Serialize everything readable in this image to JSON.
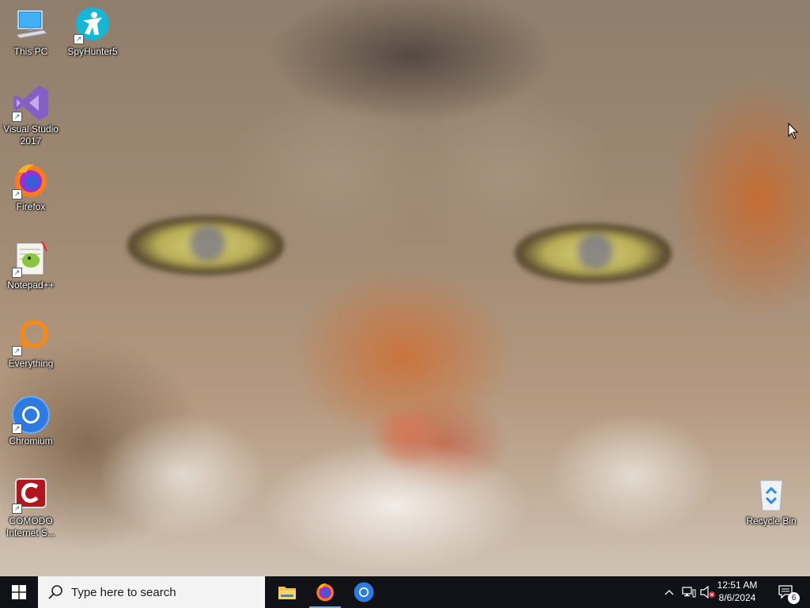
{
  "desktop": {
    "icons": [
      {
        "label": "This PC",
        "icon": "this-pc-icon"
      },
      {
        "label": "SpyHunter5",
        "icon": "spyhunter-icon"
      },
      {
        "label": "Visual Studio 2017",
        "icon": "visual-studio-icon"
      },
      {
        "label": "Firefox",
        "icon": "firefox-icon"
      },
      {
        "label": "Notepad++",
        "icon": "notepadpp-icon"
      },
      {
        "label": "Everything",
        "icon": "everything-icon"
      },
      {
        "label": "Chromium",
        "icon": "chromium-icon"
      },
      {
        "label": "COMODO Internet S...",
        "icon": "comodo-icon"
      },
      {
        "label": "Recycle Bin",
        "icon": "recycle-bin-icon"
      }
    ]
  },
  "taskbar": {
    "search_placeholder": "Type here to search",
    "pinned": [
      {
        "name": "File Explorer",
        "icon": "file-explorer-icon"
      },
      {
        "name": "Firefox",
        "icon": "firefox-icon"
      },
      {
        "name": "Chromium",
        "icon": "chromium-icon"
      }
    ],
    "clock": {
      "time": "12:51 AM",
      "date": "8/6/2024"
    },
    "notifications_count": "6"
  },
  "colors": {
    "taskbar_bg": "#111218",
    "search_bg": "#f3f3f3",
    "active_underline": "#7aa7e0"
  }
}
